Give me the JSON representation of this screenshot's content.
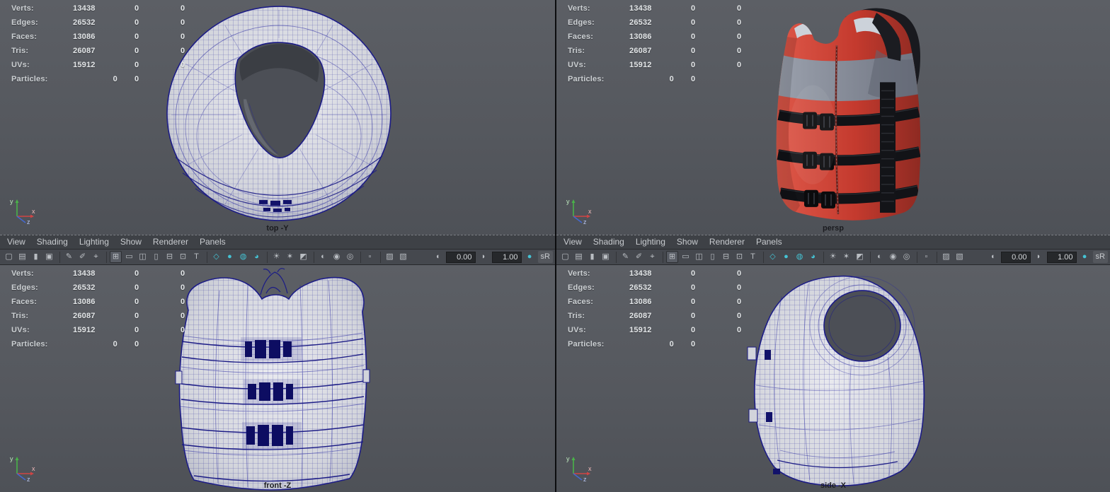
{
  "hud": {
    "rows": [
      {
        "label": "Verts:",
        "values": [
          "13438",
          "0",
          "0"
        ]
      },
      {
        "label": "Edges:",
        "values": [
          "26532",
          "0",
          "0"
        ]
      },
      {
        "label": "Faces:",
        "values": [
          "13086",
          "0",
          "0"
        ]
      },
      {
        "label": "Tris:",
        "values": [
          "26087",
          "0",
          "0"
        ]
      },
      {
        "label": "UVs:",
        "values": [
          "15912",
          "0",
          "0"
        ]
      },
      {
        "label": "Particles:",
        "values": [
          "0",
          "0",
          ""
        ],
        "first_right": true
      }
    ]
  },
  "viewports": {
    "top": {
      "label": "top -Y"
    },
    "persp": {
      "label": "persp"
    },
    "front": {
      "label": "front -Z"
    },
    "side": {
      "label": "side -X"
    }
  },
  "panel_menu": {
    "items": [
      "View",
      "Shading",
      "Lighting",
      "Show",
      "Renderer",
      "Panels"
    ]
  },
  "toolbar": {
    "items": [
      {
        "t": "icon",
        "n": "select-camera-icon",
        "g": "▢"
      },
      {
        "t": "icon",
        "n": "camera-attributes-icon",
        "g": "▤"
      },
      {
        "t": "icon",
        "n": "bookmark-icon",
        "g": "▮"
      },
      {
        "t": "icon",
        "n": "image-plane-icon",
        "g": "▣"
      },
      {
        "t": "sep"
      },
      {
        "t": "icon",
        "n": "2d-pan-zoom-icon",
        "g": "✎"
      },
      {
        "t": "icon",
        "n": "grease-pencil-icon",
        "g": "✐"
      },
      {
        "t": "icon",
        "n": "snap-view-icon",
        "g": "⌖"
      },
      {
        "t": "sep"
      },
      {
        "t": "icon",
        "n": "grid-icon",
        "g": "⊞",
        "active": true
      },
      {
        "t": "icon",
        "n": "film-gate-icon",
        "g": "▭"
      },
      {
        "t": "icon",
        "n": "resolution-gate-icon",
        "g": "◫"
      },
      {
        "t": "icon",
        "n": "gate-mask-icon",
        "g": "▯"
      },
      {
        "t": "icon",
        "n": "field-chart-icon",
        "g": "⊟"
      },
      {
        "t": "icon",
        "n": "safe-action-icon",
        "g": "⊡"
      },
      {
        "t": "icon",
        "n": "safe-title-icon",
        "g": "T"
      },
      {
        "t": "sep"
      },
      {
        "t": "icon",
        "n": "wireframe-mode-icon",
        "g": "◇",
        "teal": true
      },
      {
        "t": "icon",
        "n": "smooth-shade-icon",
        "g": "●",
        "teal": true
      },
      {
        "t": "icon",
        "n": "wireframe-on-shaded-icon",
        "g": "◍",
        "teal": true
      },
      {
        "t": "icon",
        "n": "textured-mode-icon",
        "g": "◕",
        "teal": true
      },
      {
        "t": "sep"
      },
      {
        "t": "icon",
        "n": "default-lighting-icon",
        "g": "☀"
      },
      {
        "t": "icon",
        "n": "all-lights-icon",
        "g": "✶"
      },
      {
        "t": "icon",
        "n": "shadows-icon",
        "g": "◩"
      },
      {
        "t": "sep"
      },
      {
        "t": "icon",
        "n": "occlusion-icon",
        "g": "◐"
      },
      {
        "t": "icon",
        "n": "motion-blur-icon",
        "g": "◉"
      },
      {
        "t": "icon",
        "n": "anti-alias-icon",
        "g": "◎"
      },
      {
        "t": "sep"
      },
      {
        "t": "icon",
        "n": "isolate-select-icon",
        "g": "▫"
      },
      {
        "t": "sep"
      },
      {
        "t": "icon",
        "n": "xray-icon",
        "g": "▨"
      },
      {
        "t": "icon",
        "n": "xray-joints-icon",
        "g": "▧"
      },
      {
        "t": "spacer"
      },
      {
        "t": "icon",
        "n": "exposure-icon",
        "g": "◖"
      },
      {
        "t": "field",
        "n": "exposure-field",
        "v": "0.00"
      },
      {
        "t": "icon",
        "n": "gamma-icon",
        "g": "◗"
      },
      {
        "t": "field",
        "n": "gamma-field",
        "v": "1.00"
      },
      {
        "t": "icon",
        "n": "color-management-icon",
        "g": "●",
        "teal": true
      },
      {
        "t": "btn",
        "n": "srgb-gamma-button",
        "text": "sR"
      }
    ]
  },
  "axis": {
    "x": "x",
    "y": "y",
    "z": "z"
  },
  "colors": {
    "wireframe": "#1c1c86",
    "viewport_bg": "#55585e",
    "teal": "#45c3d4",
    "vest_red": "#c43a2e",
    "strap_black": "#131418",
    "trim_gray": "#8d93a0"
  }
}
